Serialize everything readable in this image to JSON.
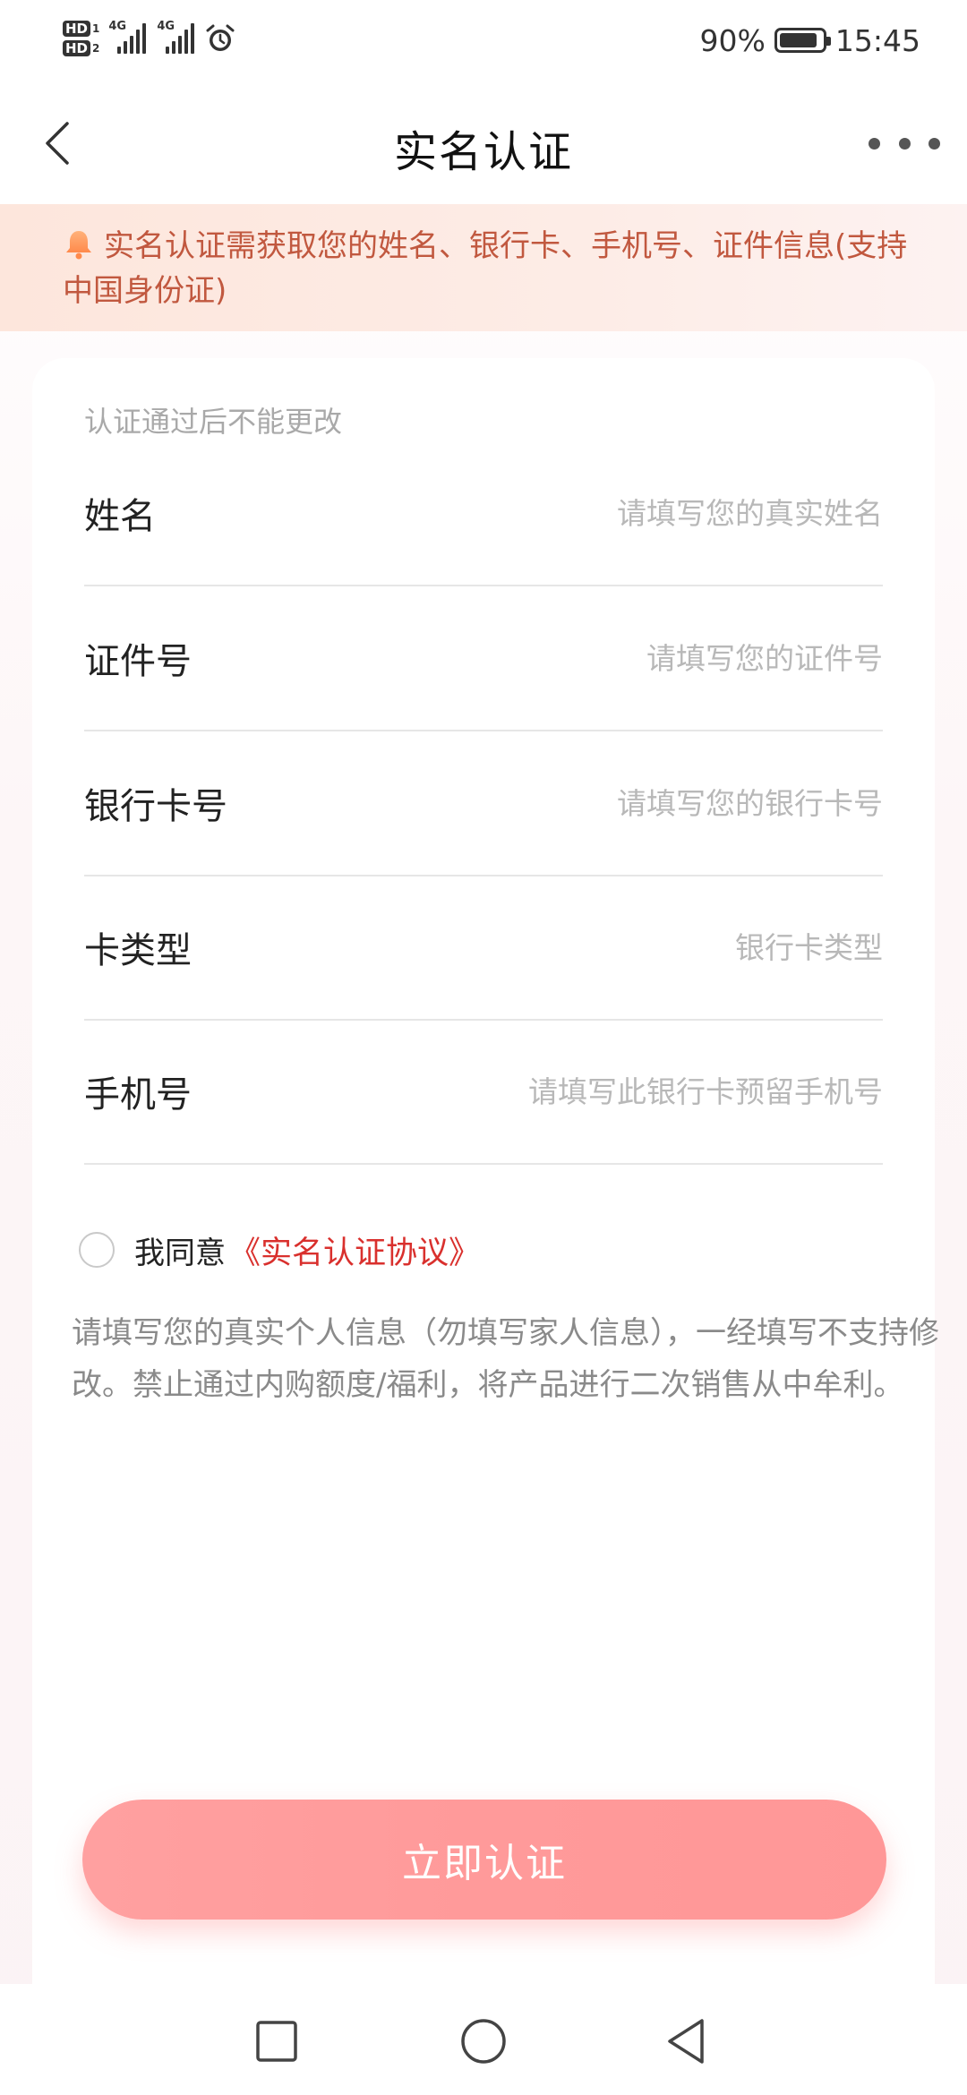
{
  "status_bar": {
    "hd1": "HD",
    "hd1_num": "1",
    "hd2": "HD",
    "hd2_num": "2",
    "sim1_type": "4G",
    "sim2_type": "4G",
    "battery_percent": "90%",
    "battery_level": 0.9,
    "time": "15:45",
    "icons": [
      "signal-icon",
      "alarm-icon",
      "battery-icon"
    ]
  },
  "nav": {
    "title": "实名认证",
    "back_icon": "chevron-left-icon",
    "more_icon": "more-dots-icon"
  },
  "notice": {
    "icon": "bell-icon",
    "text": "实名认证需获取您的姓名、银行卡、手机号、证件信息(支持中国身份证)"
  },
  "form": {
    "hint": "认证通过后不能更改",
    "fields": [
      {
        "label": "姓名",
        "placeholder": "请填写您的真实姓名",
        "value": ""
      },
      {
        "label": "证件号",
        "placeholder": "请填写您的证件号",
        "value": ""
      },
      {
        "label": "银行卡号",
        "placeholder": "请填写您的银行卡号",
        "value": ""
      },
      {
        "label": "卡类型",
        "placeholder": "银行卡类型",
        "value": ""
      },
      {
        "label": "手机号",
        "placeholder": "请填写此银行卡预留手机号",
        "value": ""
      }
    ]
  },
  "agreement": {
    "prefix": "我同意",
    "link": "《实名认证协议》",
    "checked": false
  },
  "disclaimer": "请填写您的真实个人信息（勿填写家人信息），一经填写不支持修改。禁止通过内购额度/福利，将产品进行二次销售从中牟利。",
  "submit_label": "立即认证",
  "colors": {
    "accent": "#d9302d",
    "notice_text": "#c1583f",
    "button": "#ff9a9a"
  },
  "system_nav": [
    "recent-apps-icon",
    "home-icon",
    "back-triangle-icon"
  ]
}
